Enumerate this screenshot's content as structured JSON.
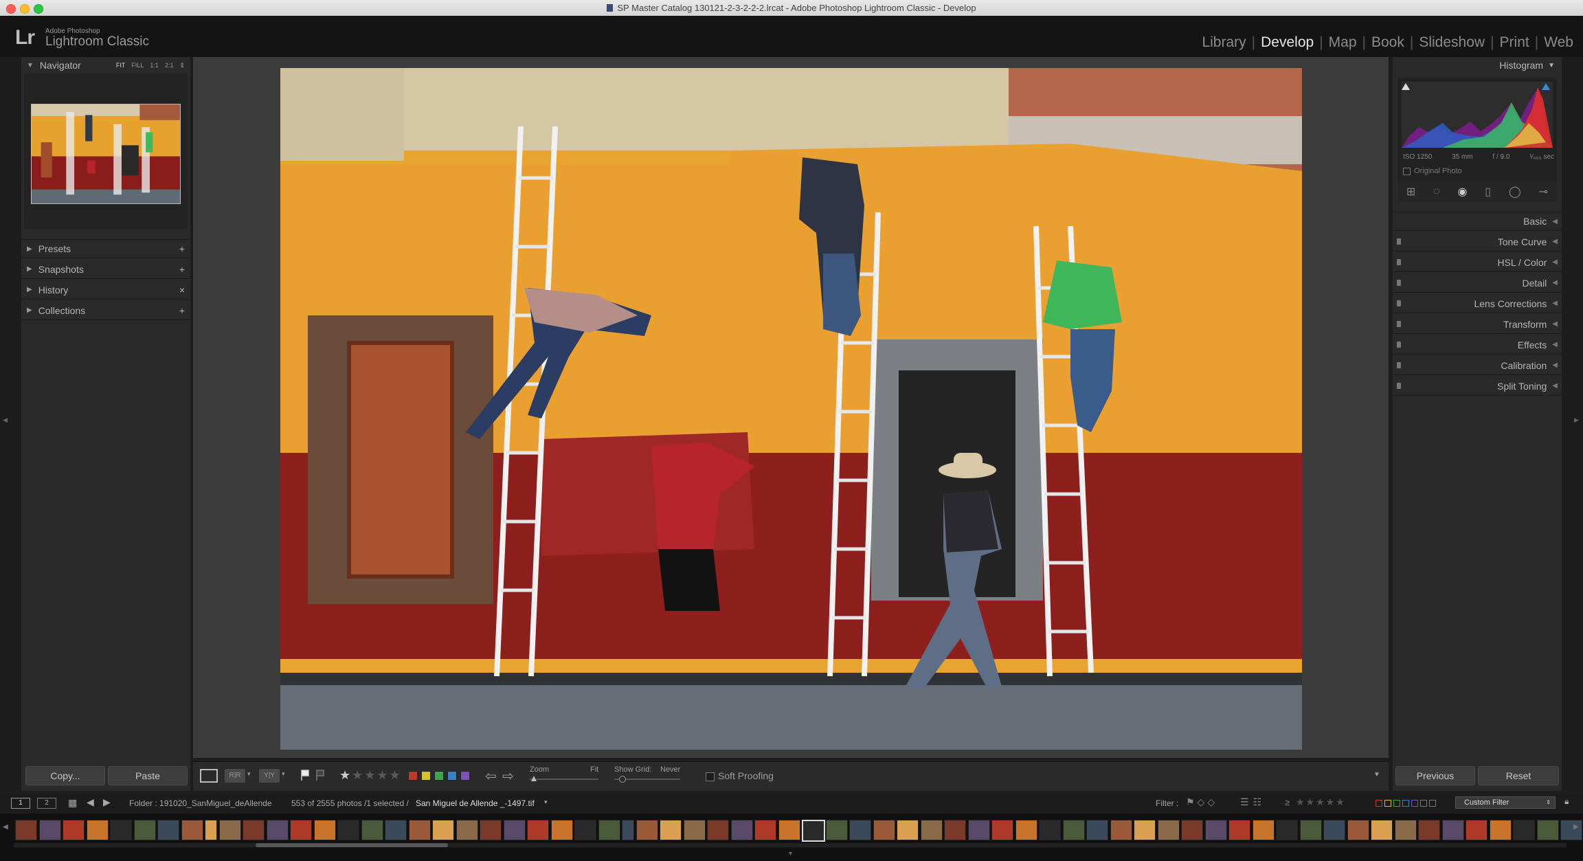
{
  "window": {
    "title": "SP Master Catalog 130121-2-3-2-2-2.lrcat - Adobe Photoshop Lightroom Classic - Develop"
  },
  "identity": {
    "small": "Adobe Photoshop",
    "big": "Lightroom Classic",
    "logo": "Lr"
  },
  "modules": [
    "Library",
    "Develop",
    "Map",
    "Book",
    "Slideshow",
    "Print",
    "Web"
  ],
  "active_module": "Develop",
  "left_panel": {
    "navigator": {
      "title": "Navigator",
      "zoom": [
        "FIT",
        "FILL",
        "1:1",
        "2:1"
      ]
    },
    "sections": [
      {
        "label": "Presets",
        "action": "+"
      },
      {
        "label": "Snapshots",
        "action": "+"
      },
      {
        "label": "History",
        "action": "×"
      },
      {
        "label": "Collections",
        "action": "+"
      }
    ],
    "copy": "Copy...",
    "paste": "Paste"
  },
  "right_panel": {
    "histogram": {
      "title": "Histogram",
      "iso": "ISO 1250",
      "focal": "35 mm",
      "aperture": "f / 9.0",
      "shutter": "¹⁄₄₀₀ sec",
      "original": "Original Photo"
    },
    "sections": [
      "Basic",
      "Tone Curve",
      "HSL / Color",
      "Detail",
      "Lens Corrections",
      "Transform",
      "Effects",
      "Calibration",
      "Split Toning"
    ],
    "previous": "Previous",
    "reset": "Reset"
  },
  "toolbar": {
    "zoom_label": "Zoom",
    "zoom_fit": "Fit",
    "grid_label": "Show Grid:",
    "grid_value": "Never",
    "soft_proofing": "Soft Proofing",
    "colors": [
      "#c0392b",
      "#d4c22b",
      "#3fa34d",
      "#3b7fc4",
      "#7b52b5"
    ]
  },
  "filmstrip": {
    "screen1": "1",
    "screen2": "2",
    "folder": "Folder : 191020_SanMiguel_deAllende",
    "count": "553 of 2555 photos /1 selected /",
    "filename": "San Miguel de Allende _-1497.tif",
    "filter_label": "Filter :",
    "filter_value": "Custom Filter"
  }
}
